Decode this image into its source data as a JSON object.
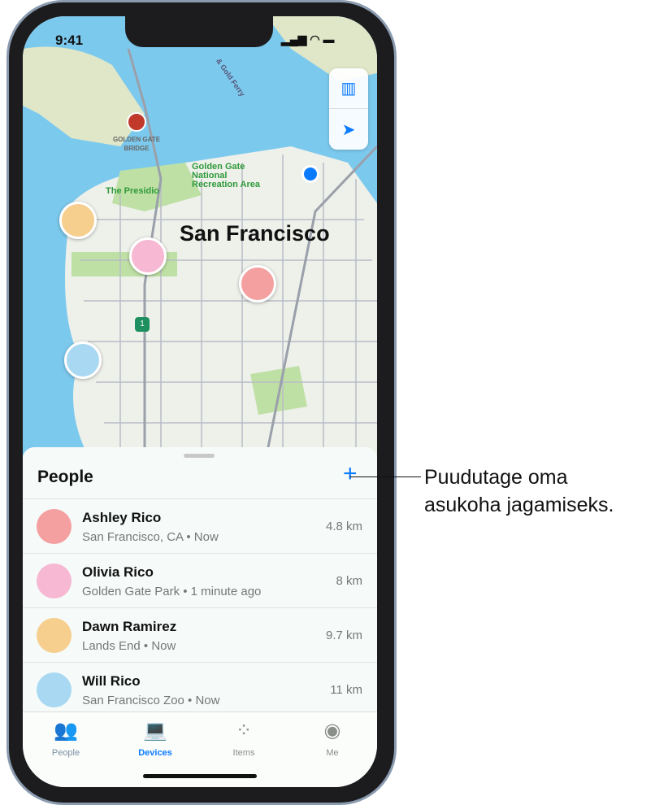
{
  "status": {
    "time": "9:41"
  },
  "map": {
    "city": "San Francisco",
    "labels": {
      "bridge": "GOLDEN GATE BRIDGE",
      "ggnra": "Golden Gate National Recreation Area",
      "presidio": "The Presidio",
      "ferry": "& Gold Ferry",
      "route": "1"
    },
    "buttons": [
      "map-icon",
      "location-arrow-icon"
    ]
  },
  "sheet": {
    "title": "People",
    "people": [
      {
        "name": "Ashley Rico",
        "sub": "San Francisco, CA • Now",
        "dist": "4.8 km",
        "color": "#f4a0a0"
      },
      {
        "name": "Olivia Rico",
        "sub": "Golden Gate Park • 1 minute ago",
        "dist": "8 km",
        "color": "#f6b8d2"
      },
      {
        "name": "Dawn Ramirez",
        "sub": "Lands End • Now",
        "dist": "9.7 km",
        "color": "#f6cf8e"
      },
      {
        "name": "Will Rico",
        "sub": "San Francisco Zoo • Now",
        "dist": "11 km",
        "color": "#a9d8f2"
      }
    ]
  },
  "tabs": [
    {
      "label": "People",
      "icon": "people-icon"
    },
    {
      "label": "Devices",
      "icon": "devices-icon"
    },
    {
      "label": "Items",
      "icon": "items-icon"
    },
    {
      "label": "Me",
      "icon": "person-circle-icon"
    }
  ],
  "callout": {
    "line1": "Puudutage oma",
    "line2": "asukoha jagamiseks."
  },
  "colors": {
    "accent": "#0a7aff",
    "water": "#7cc9ee",
    "land": "#eef0ea",
    "park": "#bfe0a5"
  }
}
